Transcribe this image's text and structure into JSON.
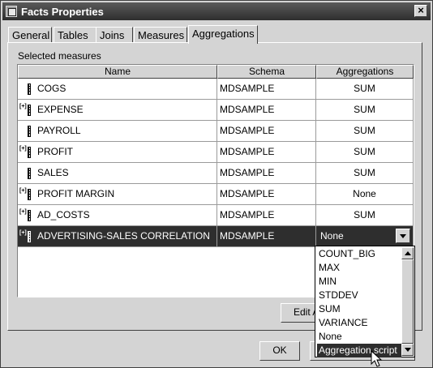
{
  "window": {
    "title": "Facts Properties",
    "close_glyph": "×"
  },
  "tabs": [
    {
      "label": "General"
    },
    {
      "label": "Tables"
    },
    {
      "label": "Joins"
    },
    {
      "label": "Measures"
    },
    {
      "label": "Aggregations",
      "active": true
    }
  ],
  "section_label": "Selected measures",
  "table": {
    "columns": [
      "Name",
      "Schema",
      "Aggregations"
    ],
    "rows": [
      {
        "name": "COGS",
        "schema": "MDSAMPLE",
        "aggregation": "SUM",
        "icon": "measure-icon",
        "calc": false
      },
      {
        "name": "EXPENSE",
        "schema": "MDSAMPLE",
        "aggregation": "SUM",
        "icon": "calculated-measure-icon",
        "calc": true
      },
      {
        "name": "PAYROLL",
        "schema": "MDSAMPLE",
        "aggregation": "SUM",
        "icon": "measure-icon",
        "calc": false
      },
      {
        "name": "PROFIT",
        "schema": "MDSAMPLE",
        "aggregation": "SUM",
        "icon": "calculated-measure-icon",
        "calc": true
      },
      {
        "name": "SALES",
        "schema": "MDSAMPLE",
        "aggregation": "SUM",
        "icon": "measure-icon",
        "calc": false
      },
      {
        "name": "PROFIT MARGIN",
        "schema": "MDSAMPLE",
        "aggregation": "None",
        "icon": "calculated-measure-icon",
        "calc": true
      },
      {
        "name": "AD_COSTS",
        "schema": "MDSAMPLE",
        "aggregation": "SUM",
        "icon": "calculated-measure-icon",
        "calc": true
      },
      {
        "name": "ADVERTISING-SALES CORRELATION",
        "schema": "MDSAMPLE",
        "aggregation": "None",
        "icon": "calculated-measure-icon",
        "calc": true,
        "selected": true
      }
    ]
  },
  "dropdown": {
    "options": [
      "COUNT_BIG",
      "MAX",
      "MIN",
      "STDDEV",
      "SUM",
      "VARIANCE",
      "None",
      "Aggregation script"
    ],
    "highlighted": "Aggregation script"
  },
  "buttons": {
    "edit_label": "Edit A",
    "ok_label": "OK",
    "cancel_label": ""
  },
  "colors": {
    "selection": "#2e2e2e",
    "dialog_bg": "#d4d4d4",
    "title_bar": "#3a3a3a"
  }
}
